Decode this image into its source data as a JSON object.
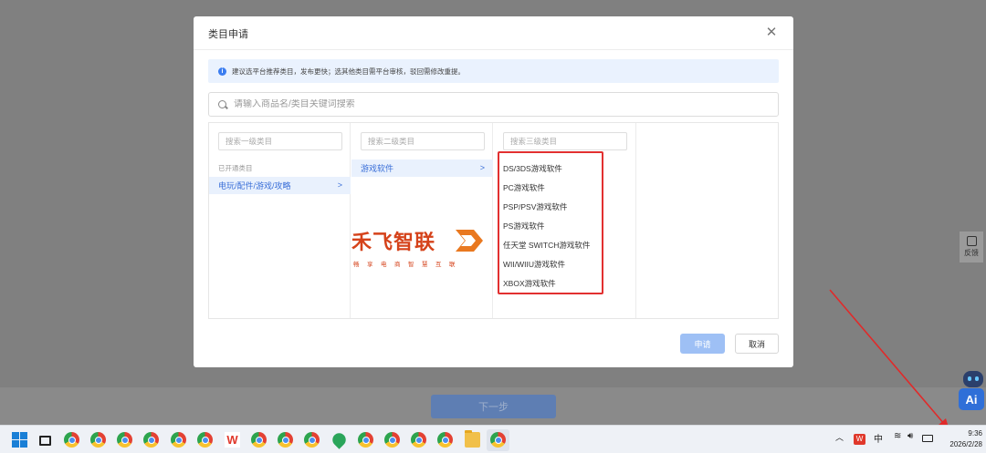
{
  "background": {
    "next_button_label": "下一步",
    "feedback_label": "反馈",
    "ai_label": "Ai"
  },
  "modal": {
    "title": "类目申请",
    "close_icon": "close-icon",
    "notice_text": "建议选平台推荐类目，发布更快；选其他类目需平台审核，驳回需修改重提。",
    "search_placeholder": "请输入商品名/类目关键词搜索",
    "columns": [
      {
        "search_placeholder": "搜索一级类目",
        "group_label": "已开通类目",
        "items": [
          "电玩/配件/游戏/攻略"
        ]
      },
      {
        "search_placeholder": "搜索二级类目",
        "items": [
          "游戏软件"
        ]
      },
      {
        "search_placeholder": "搜索三级类目",
        "items": [
          "DS/3DS游戏软件",
          "PC游戏软件",
          "PSP/PSV游戏软件",
          "PS游戏软件",
          "任天堂 SWITCH游戏软件",
          "WII/WIIU游戏软件",
          "XBOX游戏软件"
        ]
      }
    ],
    "watermark_logo": {
      "name": "禾飞智联",
      "slogan": "畅享电商智慧互联"
    },
    "apply_label": "申请",
    "cancel_label": "取消"
  },
  "taskbar": {
    "ime_label": "中",
    "time": "9:36",
    "date": "2026/2/28"
  },
  "colors": {
    "accent": "#3a6fd8",
    "highlight": "#e23030",
    "logo": "#d5421a"
  }
}
